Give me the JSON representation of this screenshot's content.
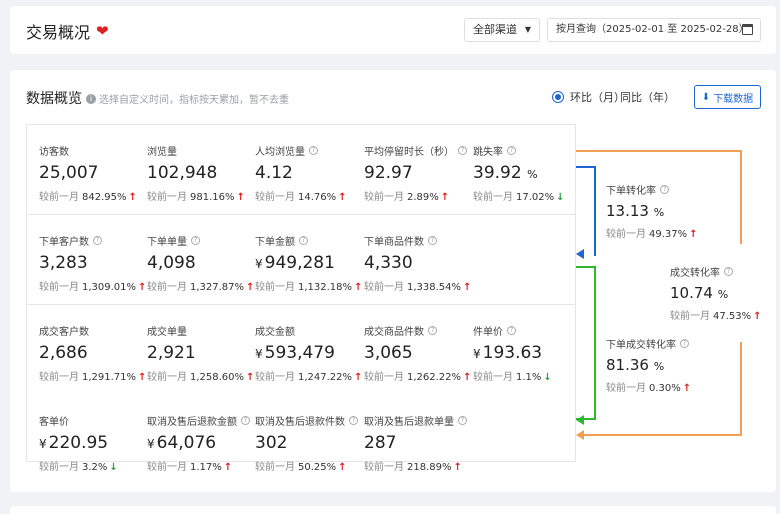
{
  "header": {
    "title": "交易概况",
    "channel": "全部渠道",
    "date_range": "按月查询（2025-02-01 至 2025-02-28）"
  },
  "panel": {
    "title": "数据概览",
    "hint": "选择自定义时间，指标按天累加，暂不去重",
    "radio_mom": "环比（月）",
    "radio_yoy": "同比（年）",
    "download": "下载数据"
  },
  "compare_prefix": "较前一月",
  "metrics": [
    {
      "label": "访客数",
      "value": "25,007",
      "change": "842.95%",
      "dir": "up"
    },
    {
      "label": "浏览量",
      "value": "102,948",
      "change": "981.16%",
      "dir": "up"
    },
    {
      "label": "人均浏览量",
      "value": "4.12",
      "change": "14.76%",
      "dir": "up"
    },
    {
      "label": "平均停留时长（秒）",
      "value": "92.97",
      "change": "2.89%",
      "dir": "up"
    },
    {
      "label": "跳失率",
      "value": "39.92",
      "unit": "%",
      "change": "17.02%",
      "dir": "down"
    },
    {
      "label": "下单客户数",
      "value": "3,283",
      "change": "1,309.01%",
      "dir": "up"
    },
    {
      "label": "下单单量",
      "value": "4,098",
      "change": "1,327.87%",
      "dir": "up"
    },
    {
      "label": "下单金额",
      "currency": "¥",
      "value": "949,281",
      "change": "1,132.18%",
      "dir": "up"
    },
    {
      "label": "下单商品件数",
      "value": "4,330",
      "change": "1,338.54%",
      "dir": "up"
    },
    {
      "label": "成交客户数",
      "value": "2,686",
      "change": "1,291.71%",
      "dir": "up"
    },
    {
      "label": "成交单量",
      "value": "2,921",
      "change": "1,258.60%",
      "dir": "up"
    },
    {
      "label": "成交金额",
      "currency": "¥",
      "value": "593,479",
      "change": "1,247.22%",
      "dir": "up"
    },
    {
      "label": "成交商品件数",
      "value": "3,065",
      "change": "1,262.22%",
      "dir": "up"
    },
    {
      "label": "件单价",
      "currency": "¥",
      "value": "193.63",
      "change": "1.1%",
      "dir": "down"
    },
    {
      "label": "客单价",
      "currency": "¥",
      "value": "220.95",
      "change": "3.2%",
      "dir": "down"
    },
    {
      "label": "取消及售后退款金额",
      "currency": "¥",
      "value": "64,076",
      "change": "1.17%",
      "dir": "up"
    },
    {
      "label": "取消及售后退款件数",
      "value": "302",
      "change": "50.25%",
      "dir": "up"
    },
    {
      "label": "取消及售后退款单量",
      "value": "287",
      "change": "218.89%",
      "dir": "up"
    }
  ],
  "rates": [
    {
      "label": "下单转化率",
      "value": "13.13",
      "unit": "%",
      "change": "49.37%",
      "dir": "up"
    },
    {
      "label": "成交转化率",
      "value": "10.74",
      "unit": "%",
      "change": "47.53%",
      "dir": "up"
    },
    {
      "label": "下单成交转化率",
      "value": "81.36",
      "unit": "%",
      "change": "0.30%",
      "dir": "up"
    }
  ],
  "colors": {
    "accent": "#1e64d2",
    "up": "#e02020",
    "down": "#2ea043",
    "flow_orange": "#f0a050",
    "flow_green": "#2eb82e"
  }
}
